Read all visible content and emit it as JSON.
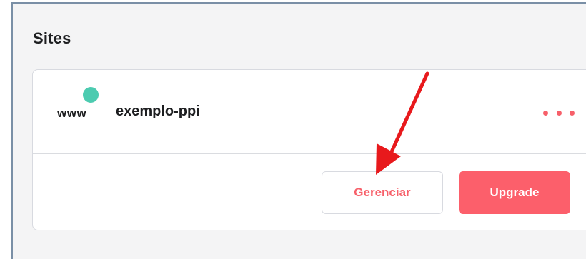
{
  "panel": {
    "title": "Sites"
  },
  "site": {
    "icon_text": "www",
    "name": "exemplo-ppi",
    "status_color": "#4ccbb0"
  },
  "actions": {
    "manage_label": "Gerenciar",
    "upgrade_label": "Upgrade",
    "more_icon": "more-horizontal-icon"
  },
  "colors": {
    "accent": "#fc5f6b",
    "annotation_arrow": "#e8191c"
  }
}
